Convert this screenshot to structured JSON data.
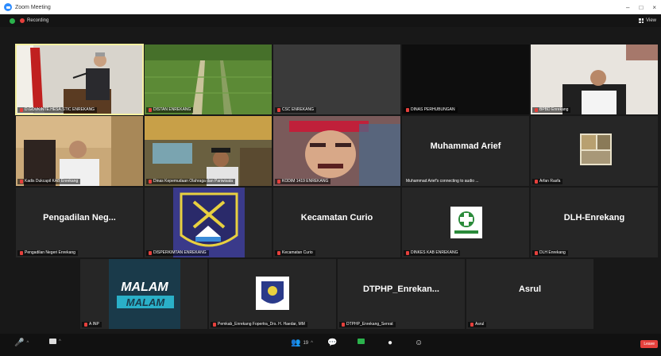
{
  "window": {
    "title": "Zoom Meeting"
  },
  "topbar": {
    "recording_label": "Recording",
    "view_label": "View"
  },
  "colors": {
    "accent": "#2d8cff",
    "recording": "#e5403c",
    "speaker_border": "#f5f0a0",
    "leave": "#e5403c"
  },
  "tiles": [
    {
      "name": "D.GOVKINTE.HESA.STIC ENREKANG",
      "type": "video"
    },
    {
      "name": "DISTAN ENREKANG",
      "type": "video"
    },
    {
      "name": "CSC ENREKANG",
      "type": "blank"
    },
    {
      "name": "DINAS PERHUBUNGAN",
      "type": "blank"
    },
    {
      "name": "BPBD Enrekang",
      "type": "video"
    },
    {
      "name": "Kadis Dukcapil KAB Enrekang",
      "type": "video"
    },
    {
      "name": "Dinas Kepemudaan Olahraga dan Pariwisata",
      "type": "video"
    },
    {
      "name": "KODIM 1419 ENREKANG",
      "type": "video"
    },
    {
      "name": "Muhammad Arief's connecting to audio ...",
      "display": "Muhammad Arief",
      "type": "name"
    },
    {
      "name": "Arfan Rasfa",
      "type": "video"
    },
    {
      "name": "Pengadilan Negeri Enrekang",
      "display": "Pengadilan Neg...",
      "type": "name"
    },
    {
      "name": "DISPERKIMTAN ENREKANG",
      "type": "logo"
    },
    {
      "name": "Kecamatan Curio",
      "display": "Kecamatan Curio",
      "type": "name"
    },
    {
      "name": "DINKES KAB ENREKANG",
      "type": "logo"
    },
    {
      "name": "DLH Enrekang",
      "display": "DLH-Enrekang",
      "type": "name"
    },
    {
      "name": "A INP",
      "type": "logo"
    },
    {
      "name": "Pemkab_Enrekang Fopertra_Drs. H. Haedar, MM",
      "type": "logo"
    },
    {
      "name": "DTPHP_Enrekang_Senrat",
      "display": "DTPHP_Enrekan...",
      "type": "name"
    },
    {
      "name": "Asrul",
      "display": "Asrul",
      "type": "name"
    }
  ],
  "logos": {
    "malam": "MALAM"
  },
  "toolbar": {
    "participants_count": "19",
    "leave_label": "Leave"
  }
}
